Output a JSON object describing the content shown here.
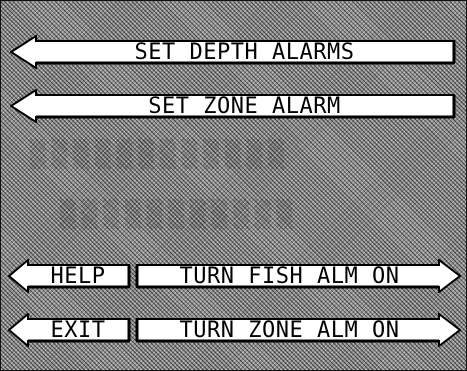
{
  "menu": {
    "set_depth_alarms": "SET DEPTH ALARMS",
    "set_zone_alarm": "SET ZONE ALARM",
    "help": "HELP",
    "exit": "EXIT",
    "turn_fish_alarm_on": "TURN FISH ALM ON",
    "turn_zone_alarm_on": "TURN ZONE ALM ON"
  },
  "colors": {
    "button_face": "#ffffff",
    "outline": "#000000",
    "background": "#8f8f8f"
  },
  "icons": {
    "left_arrow": "left-arrow-icon",
    "right_arrow": "right-arrow-icon"
  }
}
